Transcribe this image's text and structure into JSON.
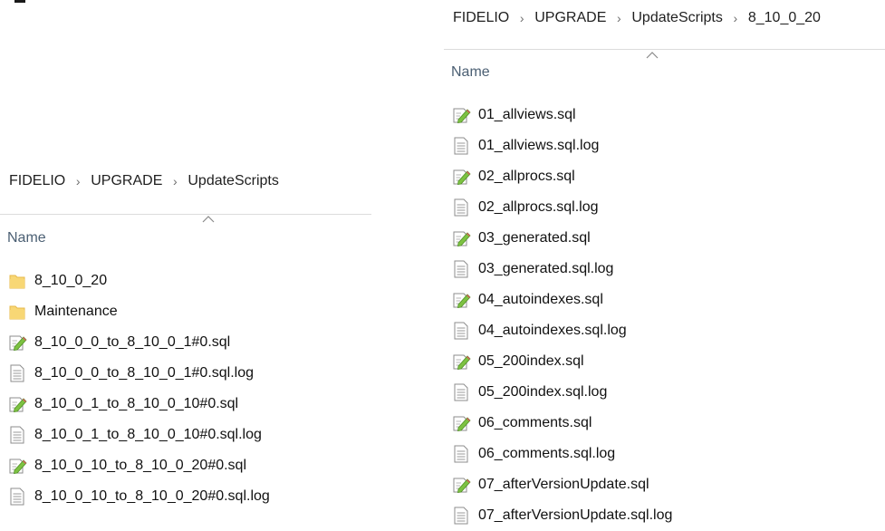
{
  "left_pane": {
    "breadcrumb": [
      "FIDELIO",
      "UPGRADE",
      "UpdateScripts"
    ],
    "column_header": "Name",
    "items": [
      {
        "name": "8_10_0_20",
        "icon": "folder-icon"
      },
      {
        "name": "Maintenance",
        "icon": "folder-icon"
      },
      {
        "name": "8_10_0_0_to_8_10_0_1#0.sql",
        "icon": "sql-file-icon"
      },
      {
        "name": "8_10_0_0_to_8_10_0_1#0.sql.log",
        "icon": "text-file-icon"
      },
      {
        "name": "8_10_0_1_to_8_10_0_10#0.sql",
        "icon": "sql-file-icon"
      },
      {
        "name": "8_10_0_1_to_8_10_0_10#0.sql.log",
        "icon": "text-file-icon"
      },
      {
        "name": "8_10_0_10_to_8_10_0_20#0.sql",
        "icon": "sql-file-icon"
      },
      {
        "name": "8_10_0_10_to_8_10_0_20#0.sql.log",
        "icon": "text-file-icon"
      }
    ]
  },
  "right_pane": {
    "breadcrumb": [
      "FIDELIO",
      "UPGRADE",
      "UpdateScripts",
      "8_10_0_20"
    ],
    "column_header": "Name",
    "items": [
      {
        "name": "01_allviews.sql",
        "icon": "sql-file-icon"
      },
      {
        "name": "01_allviews.sql.log",
        "icon": "text-file-icon"
      },
      {
        "name": "02_allprocs.sql",
        "icon": "sql-file-icon"
      },
      {
        "name": "02_allprocs.sql.log",
        "icon": "text-file-icon"
      },
      {
        "name": "03_generated.sql",
        "icon": "sql-file-icon"
      },
      {
        "name": "03_generated.sql.log",
        "icon": "text-file-icon"
      },
      {
        "name": "04_autoindexes.sql",
        "icon": "sql-file-icon"
      },
      {
        "name": "04_autoindexes.sql.log",
        "icon": "text-file-icon"
      },
      {
        "name": "05_200index.sql",
        "icon": "sql-file-icon"
      },
      {
        "name": "05_200index.sql.log",
        "icon": "text-file-icon"
      },
      {
        "name": "06_comments.sql",
        "icon": "sql-file-icon"
      },
      {
        "name": "06_comments.sql.log",
        "icon": "text-file-icon"
      },
      {
        "name": "07_afterVersionUpdate.sql",
        "icon": "sql-file-icon"
      },
      {
        "name": "07_afterVersionUpdate.sql.log",
        "icon": "text-file-icon"
      }
    ]
  },
  "colors": {
    "folder": "#F8D775",
    "folder_dark": "#E7B84A",
    "header_text": "#4B5F73",
    "pencil_green": "#7DC242"
  }
}
